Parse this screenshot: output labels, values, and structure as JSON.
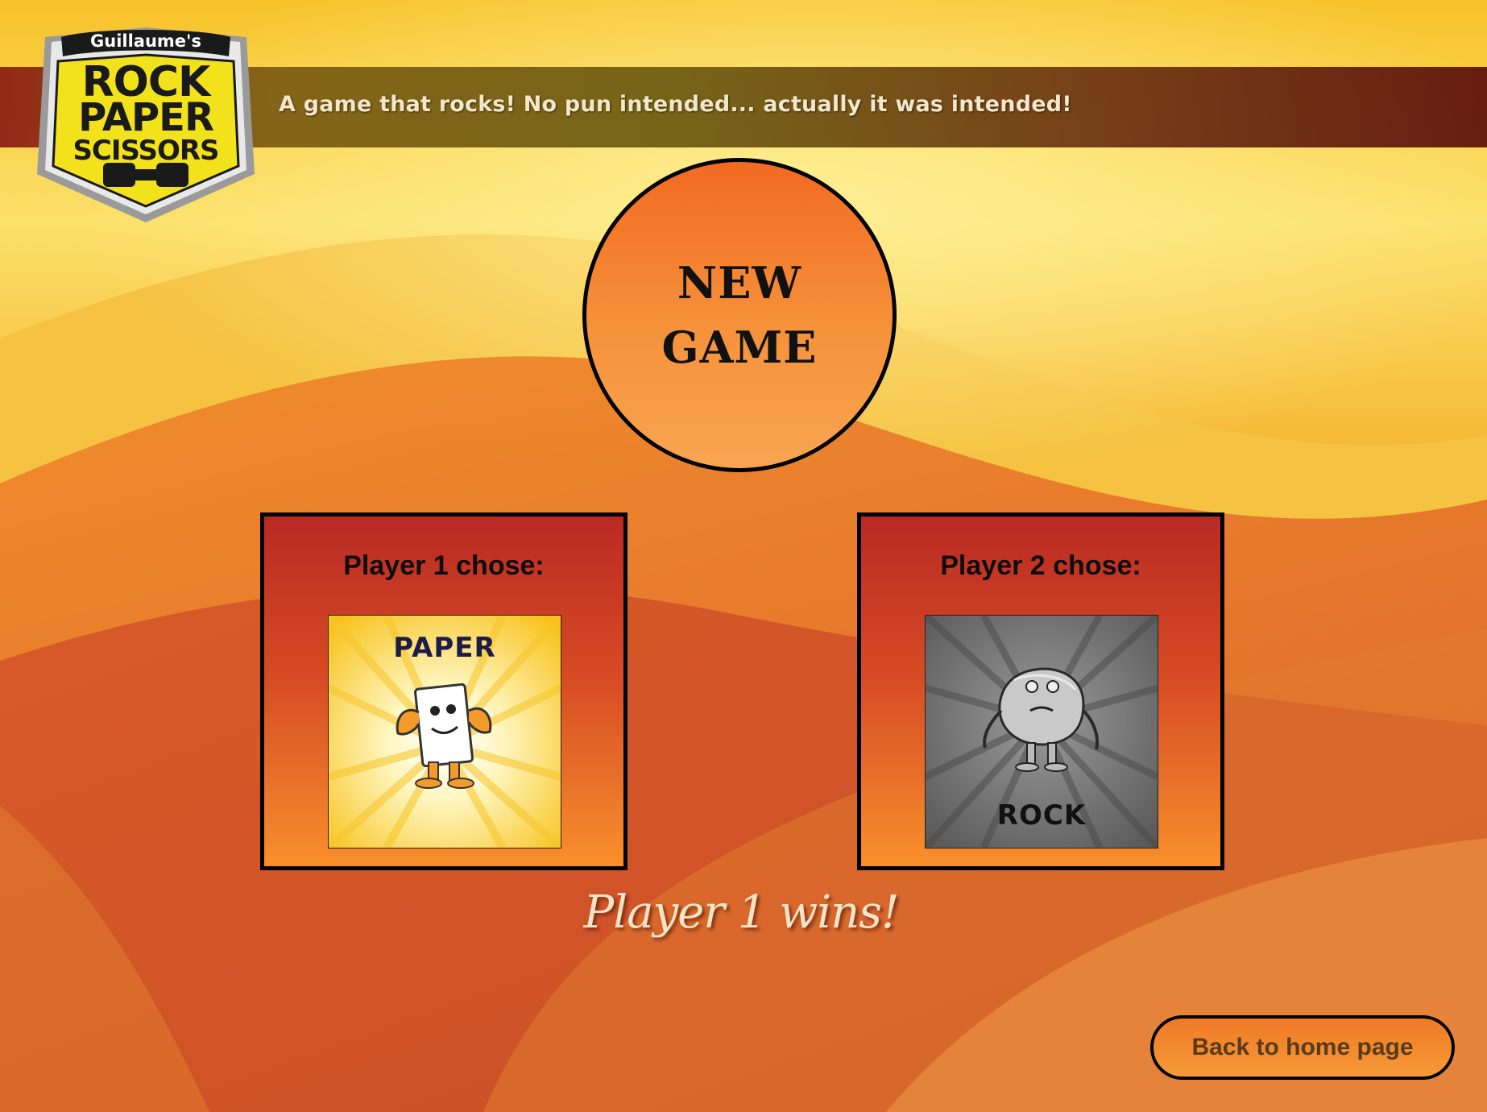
{
  "header": {
    "logo": {
      "owner": "Guillaume's",
      "line1": "ROCK",
      "line2": "PAPER",
      "line3": "SCISSORS"
    },
    "tagline": "A game that rocks! No pun intended... actually it was intended!"
  },
  "new_game": {
    "line1": "NEW",
    "line2": "GAME"
  },
  "players": [
    {
      "label": "Player 1 chose:",
      "choice": "PAPER"
    },
    {
      "label": "Player 2 chose:",
      "choice": "ROCK"
    }
  ],
  "result": "Player 1 wins!",
  "back_button": "Back to home page",
  "colors": {
    "accent_orange": "#f26a22",
    "panel_red": "#b82a24",
    "banner_dark": "#6a3010",
    "result_text": "#f7e3c5"
  }
}
